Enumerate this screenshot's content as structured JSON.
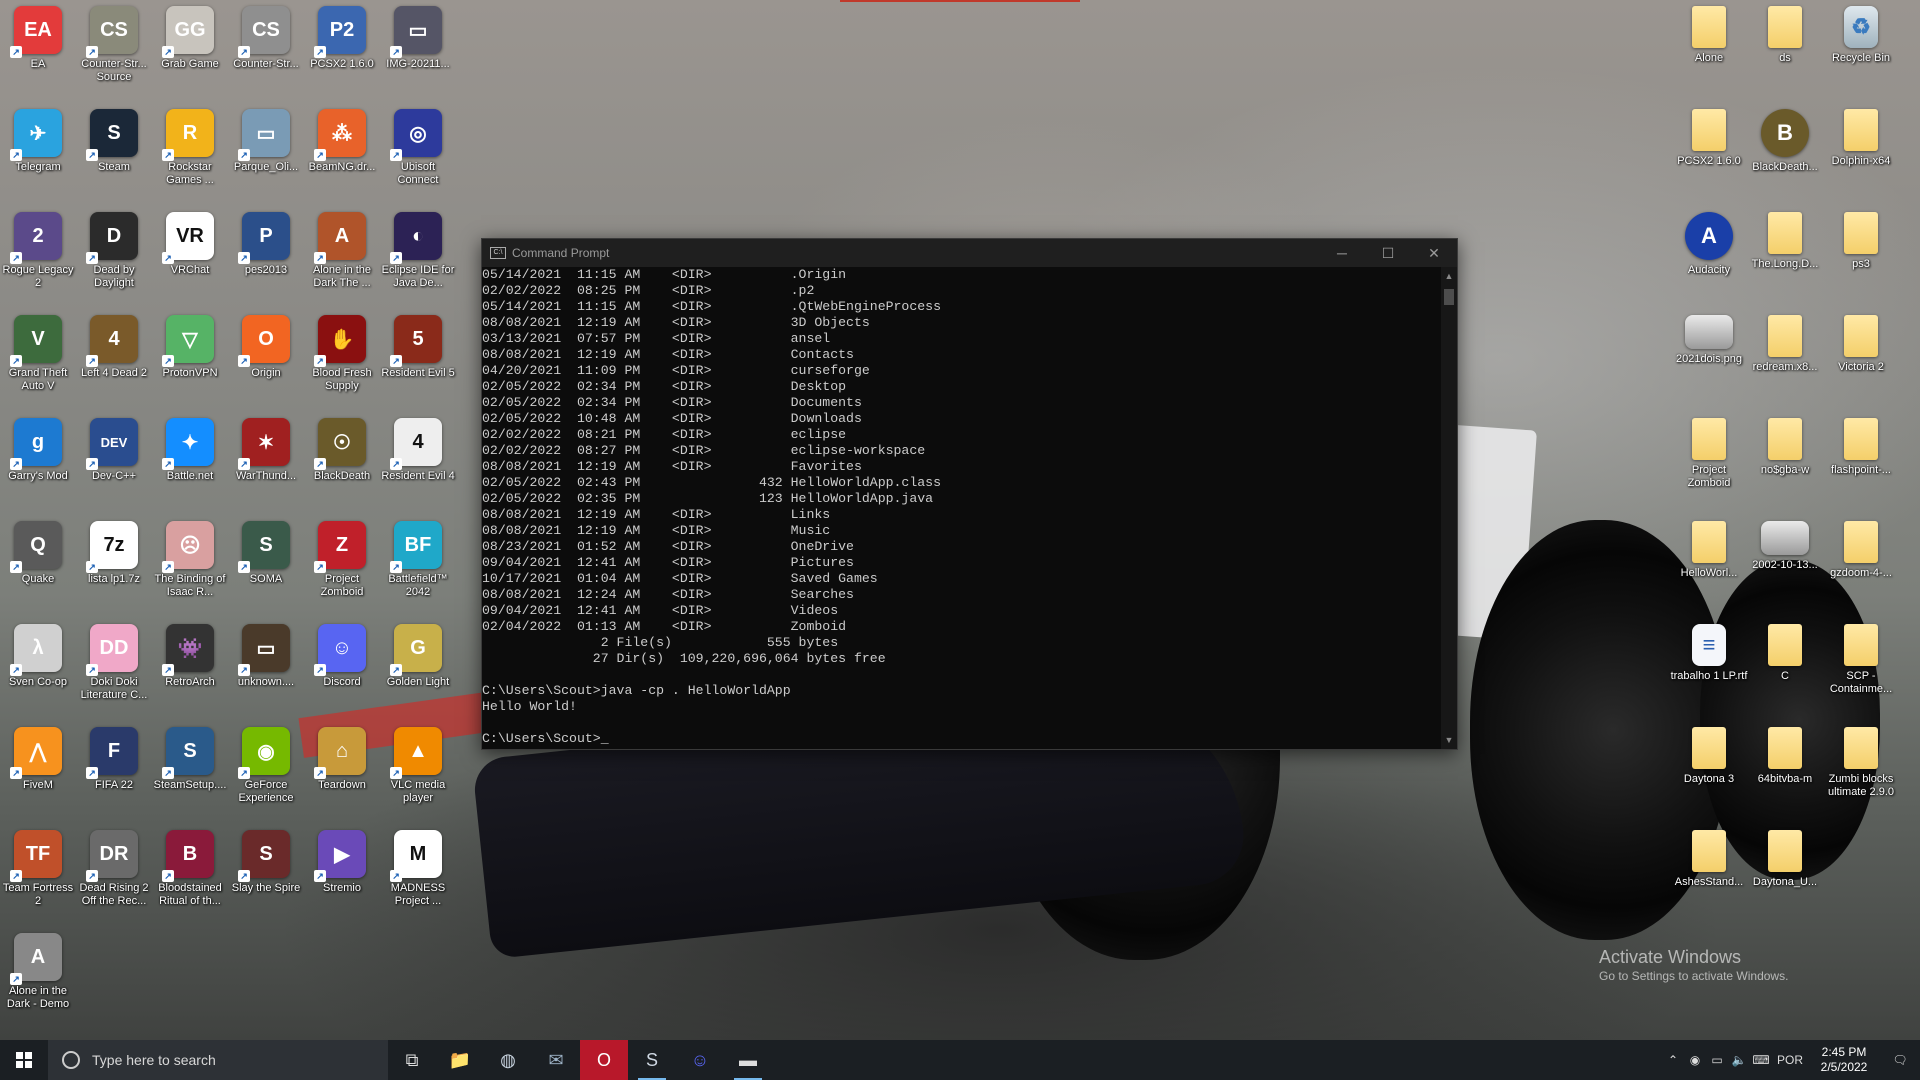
{
  "desktop": {
    "left_icons": [
      {
        "label": "EA",
        "color": "#e33b3b",
        "glyph": "EA"
      },
      {
        "label": "Counter-Str... Source",
        "color": "#8a8a7a",
        "glyph": "CS"
      },
      {
        "label": "Grab Game",
        "color": "#c8c4bd",
        "glyph": "GG"
      },
      {
        "label": "Counter-Str...",
        "color": "#8f8f8f",
        "glyph": "CS"
      },
      {
        "label": "PCSX2 1.6.0",
        "color": "#3b67b0",
        "glyph": "P2"
      },
      {
        "label": "IMG-20211...",
        "color": "#556",
        "glyph": "▭"
      },
      {
        "label": "Telegram",
        "color": "#2aa3df",
        "glyph": "✈"
      },
      {
        "label": "Steam",
        "color": "#1b2838",
        "glyph": "S"
      },
      {
        "label": "Rockstar Games ...",
        "color": "#f2b31a",
        "glyph": "R"
      },
      {
        "label": "Parque_Oli...",
        "color": "#7a9bb5",
        "glyph": "▭"
      },
      {
        "label": "BeamNG.dr...",
        "color": "#e8622a",
        "glyph": "⁂"
      },
      {
        "label": "Ubisoft Connect",
        "color": "#2d3a9c",
        "glyph": "◎"
      },
      {
        "label": "Rogue Legacy 2",
        "color": "#5b4a8a",
        "glyph": "2"
      },
      {
        "label": "Dead by Daylight",
        "color": "#2b2b2b",
        "glyph": "D"
      },
      {
        "label": "VRChat",
        "color": "#ffffff",
        "glyph": "VR"
      },
      {
        "label": "pes2013",
        "color": "#2b4f8a",
        "glyph": "P"
      },
      {
        "label": "Alone in the Dark The ...",
        "color": "#b0542a",
        "glyph": "A"
      },
      {
        "label": "Eclipse IDE for Java De...",
        "color": "#2c2255",
        "glyph": "◐"
      },
      {
        "label": "Grand Theft Auto V",
        "color": "#3d6b3d",
        "glyph": "V"
      },
      {
        "label": "Left 4 Dead 2",
        "color": "#7a5a2a",
        "glyph": "4"
      },
      {
        "label": "ProtonVPN",
        "color": "#56b366",
        "glyph": "▽"
      },
      {
        "label": "Origin",
        "color": "#f26522",
        "glyph": "O"
      },
      {
        "label": "Blood Fresh Supply",
        "color": "#8a1010",
        "glyph": "✋"
      },
      {
        "label": "Resident Evil 5",
        "color": "#8a2a1a",
        "glyph": "5"
      },
      {
        "label": "Garry's Mod",
        "color": "#1d7ad1",
        "glyph": "g"
      },
      {
        "label": "Dev-C++",
        "color": "#2a4d8f",
        "glyph": "DEV"
      },
      {
        "label": "Battle.net",
        "color": "#148eff",
        "glyph": "✦"
      },
      {
        "label": "WarThund...",
        "color": "#a02020",
        "glyph": "✶"
      },
      {
        "label": "BlackDeath",
        "color": "#6a5a2a",
        "glyph": "☉"
      },
      {
        "label": "Resident Evil 4",
        "color": "#eeeeee",
        "glyph": "4"
      },
      {
        "label": "Quake",
        "color": "#5a5a5a",
        "glyph": "Q"
      },
      {
        "label": "lista lp1.7z",
        "color": "#ffffff",
        "glyph": "7z"
      },
      {
        "label": "The Binding of Isaac R...",
        "color": "#d9a0a0",
        "glyph": "☹"
      },
      {
        "label": "SOMA",
        "color": "#3a5a4a",
        "glyph": "S"
      },
      {
        "label": "Project Zomboid",
        "color": "#c0202a",
        "glyph": "Z"
      },
      {
        "label": "Battlefield™ 2042",
        "color": "#1fa8c9",
        "glyph": "BF"
      },
      {
        "label": "Sven Co-op",
        "color": "#d0d0d0",
        "glyph": "λ"
      },
      {
        "label": "Doki Doki Literature C...",
        "color": "#f0a8c8",
        "glyph": "DD"
      },
      {
        "label": "RetroArch",
        "color": "#333",
        "glyph": "👾"
      },
      {
        "label": "unknown....",
        "color": "#4a3a2a",
        "glyph": "▭"
      },
      {
        "label": "Discord",
        "color": "#5865f2",
        "glyph": "☺"
      },
      {
        "label": "Golden Light",
        "color": "#c8b04a",
        "glyph": "G"
      },
      {
        "label": "FiveM",
        "color": "#f7921e",
        "glyph": "⋀"
      },
      {
        "label": "FIFA 22",
        "color": "#2a3a6a",
        "glyph": "F"
      },
      {
        "label": "SteamSetup....",
        "color": "#2a5a8a",
        "glyph": "S"
      },
      {
        "label": "GeForce Experience",
        "color": "#76b900",
        "glyph": "◉"
      },
      {
        "label": "Teardown",
        "color": "#c89a3a",
        "glyph": "⌂"
      },
      {
        "label": "VLC media player",
        "color": "#f08a00",
        "glyph": "▲"
      },
      {
        "label": "Team Fortress 2",
        "color": "#c0502a",
        "glyph": "TF"
      },
      {
        "label": "Dead Rising 2 Off the Rec...",
        "color": "#6a6a6a",
        "glyph": "DR"
      },
      {
        "label": "Bloodstained Ritual of th...",
        "color": "#8a1a3a",
        "glyph": "B"
      },
      {
        "label": "Slay the Spire",
        "color": "#6a2a2a",
        "glyph": "S"
      },
      {
        "label": "Stremio",
        "color": "#6a4ab8",
        "glyph": "▶"
      },
      {
        "label": "MADNESS Project ...",
        "color": "#ffffff",
        "glyph": "M"
      },
      {
        "label": "Alone in the Dark - Demo",
        "color": "#888",
        "glyph": "A"
      }
    ],
    "right_icons": [
      {
        "label": "Alone",
        "kind": "folder"
      },
      {
        "label": "ds",
        "kind": "folder"
      },
      {
        "label": "Recycle Bin",
        "kind": "bin"
      },
      {
        "label": "PCSX2 1.6.0",
        "kind": "folder"
      },
      {
        "label": "BlackDeath...",
        "kind": "app",
        "color": "#6a5a2a"
      },
      {
        "label": "Dolphin-x64",
        "kind": "folder"
      },
      {
        "label": "Audacity",
        "kind": "app",
        "color": "#1a3fa8"
      },
      {
        "label": "The.Long.D...",
        "kind": "folder"
      },
      {
        "label": "ps3",
        "kind": "folder"
      },
      {
        "label": "2021dois.png",
        "kind": "image"
      },
      {
        "label": "redream.x8...",
        "kind": "folder"
      },
      {
        "label": "Victoria 2",
        "kind": "folder"
      },
      {
        "label": "Project Zomboid",
        "kind": "folder"
      },
      {
        "label": "no$gba-w",
        "kind": "folder"
      },
      {
        "label": "flashpoint-...",
        "kind": "folder"
      },
      {
        "label": "HelloWorl...",
        "kind": "file"
      },
      {
        "label": "2002-10-13...",
        "kind": "image"
      },
      {
        "label": "gzdoom-4-...",
        "kind": "folder"
      },
      {
        "label": "trabalho 1 LP.rtf",
        "kind": "doc"
      },
      {
        "label": "C",
        "kind": "folder"
      },
      {
        "label": "SCP - Containme...",
        "kind": "folder"
      },
      {
        "label": "Daytona 3",
        "kind": "folder"
      },
      {
        "label": "64bitvba-m",
        "kind": "folder"
      },
      {
        "label": "Zumbi blocks ultimate 2.9.0",
        "kind": "folder"
      },
      {
        "label": "AshesStand...",
        "kind": "folder"
      },
      {
        "label": "Daytona_U...",
        "kind": "folder"
      }
    ]
  },
  "cmd_window": {
    "title": "Command Prompt",
    "lines": [
      "05/14/2021  11:15 AM    <DIR>          .Origin",
      "02/02/2022  08:25 PM    <DIR>          .p2",
      "05/14/2021  11:15 AM    <DIR>          .QtWebEngineProcess",
      "08/08/2021  12:19 AM    <DIR>          3D Objects",
      "03/13/2021  07:57 PM    <DIR>          ansel",
      "08/08/2021  12:19 AM    <DIR>          Contacts",
      "04/20/2021  11:09 PM    <DIR>          curseforge",
      "02/05/2022  02:34 PM    <DIR>          Desktop",
      "02/05/2022  02:34 PM    <DIR>          Documents",
      "02/05/2022  10:48 AM    <DIR>          Downloads",
      "02/02/2022  08:21 PM    <DIR>          eclipse",
      "02/02/2022  08:27 PM    <DIR>          eclipse-workspace",
      "08/08/2021  12:19 AM    <DIR>          Favorites",
      "02/05/2022  02:43 PM               432 HelloWorldApp.class",
      "02/05/2022  02:35 PM               123 HelloWorldApp.java",
      "08/08/2021  12:19 AM    <DIR>          Links",
      "08/08/2021  12:19 AM    <DIR>          Music",
      "08/23/2021  01:52 AM    <DIR>          OneDrive",
      "09/04/2021  12:41 AM    <DIR>          Pictures",
      "10/17/2021  01:04 AM    <DIR>          Saved Games",
      "08/08/2021  12:24 AM    <DIR>          Searches",
      "09/04/2021  12:41 AM    <DIR>          Videos",
      "02/04/2022  01:13 AM    <DIR>          Zomboid",
      "               2 File(s)            555 bytes",
      "              27 Dir(s)  109,220,696,064 bytes free",
      "",
      "C:\\Users\\Scout>java -cp . HelloWorldApp",
      "Hello World!",
      "",
      "C:\\Users\\Scout>"
    ]
  },
  "watermark": {
    "title": "Activate Windows",
    "subtitle": "Go to Settings to activate Windows."
  },
  "taskbar": {
    "search_placeholder": "Type here to search",
    "apps": [
      {
        "name": "task-view",
        "glyph": "⧉"
      },
      {
        "name": "file-explorer",
        "glyph": "📁"
      },
      {
        "name": "firefox-like-browser",
        "glyph": "◍"
      },
      {
        "name": "mail",
        "glyph": "✉"
      },
      {
        "name": "opera",
        "glyph": "O"
      },
      {
        "name": "steam",
        "glyph": "S"
      },
      {
        "name": "discord",
        "glyph": "☺"
      },
      {
        "name": "command-prompt",
        "glyph": "▬"
      }
    ],
    "tray": {
      "language": "POR",
      "time": "2:45 PM",
      "date": "2/5/2022"
    }
  }
}
